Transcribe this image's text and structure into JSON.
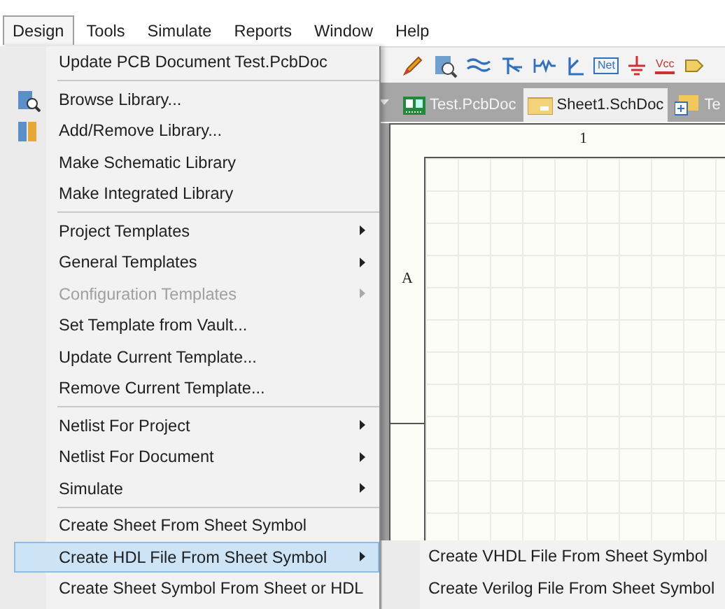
{
  "menubar": [
    {
      "label": "Design",
      "selected": true
    },
    {
      "label": "Tools",
      "selected": false
    },
    {
      "label": "Simulate",
      "selected": false
    },
    {
      "label": "Reports",
      "selected": false
    },
    {
      "label": "Window",
      "selected": false
    },
    {
      "label": "Help",
      "selected": false
    }
  ],
  "toolbar": {
    "net_label": "Net",
    "vcc_label": "Vcc"
  },
  "tabs": [
    {
      "label": "Test.PcbDoc",
      "selected": false,
      "kind": "pcb"
    },
    {
      "label": "Sheet1.SchDoc",
      "selected": true,
      "kind": "sch"
    },
    {
      "label": "Te",
      "selected": false,
      "kind": "project"
    }
  ],
  "sheet": {
    "column_label": "1",
    "row_label": "A"
  },
  "menu": {
    "sections": [
      [
        {
          "label": "Update PCB Document Test.PcbDoc",
          "submenu": false,
          "disabled": false,
          "selected": false
        }
      ],
      [
        {
          "label": "Browse Library...",
          "submenu": false,
          "disabled": false,
          "selected": false
        },
        {
          "label": "Add/Remove Library...",
          "submenu": false,
          "disabled": false,
          "selected": false
        },
        {
          "label": "Make Schematic Library",
          "submenu": false,
          "disabled": false,
          "selected": false
        },
        {
          "label": "Make Integrated Library",
          "submenu": false,
          "disabled": false,
          "selected": false
        }
      ],
      [
        {
          "label": "Project Templates",
          "submenu": true,
          "disabled": false,
          "selected": false
        },
        {
          "label": "General Templates",
          "submenu": true,
          "disabled": false,
          "selected": false
        },
        {
          "label": "Configuration Templates",
          "submenu": true,
          "disabled": true,
          "selected": false
        },
        {
          "label": "Set Template from Vault...",
          "submenu": false,
          "disabled": false,
          "selected": false
        },
        {
          "label": "Update Current Template...",
          "submenu": false,
          "disabled": false,
          "selected": false
        },
        {
          "label": "Remove Current Template...",
          "submenu": false,
          "disabled": false,
          "selected": false
        }
      ],
      [
        {
          "label": "Netlist For Project",
          "submenu": true,
          "disabled": false,
          "selected": false
        },
        {
          "label": "Netlist For Document",
          "submenu": true,
          "disabled": false,
          "selected": false
        },
        {
          "label": "Simulate",
          "submenu": true,
          "disabled": false,
          "selected": false
        }
      ],
      [
        {
          "label": "Create Sheet From Sheet Symbol",
          "submenu": false,
          "disabled": false,
          "selected": false
        },
        {
          "label": "Create HDL File From Sheet Symbol",
          "submenu": true,
          "disabled": false,
          "selected": true
        },
        {
          "label": "Create Sheet Symbol From Sheet or HDL",
          "submenu": false,
          "disabled": false,
          "selected": false
        }
      ]
    ]
  },
  "submenu": {
    "items": [
      {
        "label": "Create VHDL File From Sheet Symbol"
      },
      {
        "label": "Create Verilog File From Sheet Symbol"
      }
    ]
  }
}
